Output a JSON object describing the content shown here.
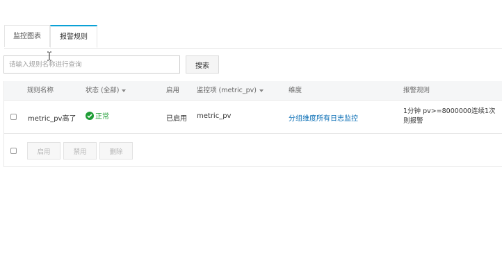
{
  "tabs": [
    {
      "label": "监控图表"
    },
    {
      "label": "报警规则"
    }
  ],
  "search": {
    "placeholder": "请输入规则名称进行查询",
    "button_label": "搜索"
  },
  "table": {
    "headers": {
      "name": "规则名称",
      "status": "状态 (全部)",
      "enabled": "启用",
      "metric": "监控项 (metric_pv)",
      "dimension": "维度",
      "rule": "报警规则"
    },
    "rows": [
      {
        "name": "metric_pv高了",
        "status": "正常",
        "enabled": "已启用",
        "metric": "metric_pv",
        "dimension": "分组维度所有日志监控",
        "rule": "1分钟 pv>=8000000连续1次 则报警"
      }
    ]
  },
  "footer": {
    "enable_label": "启用",
    "disable_label": "禁用",
    "delete_label": "删除"
  },
  "colors": {
    "accent": "#0aa1d6",
    "status_ok": "#1e9d35",
    "link": "#0b6fb6"
  }
}
